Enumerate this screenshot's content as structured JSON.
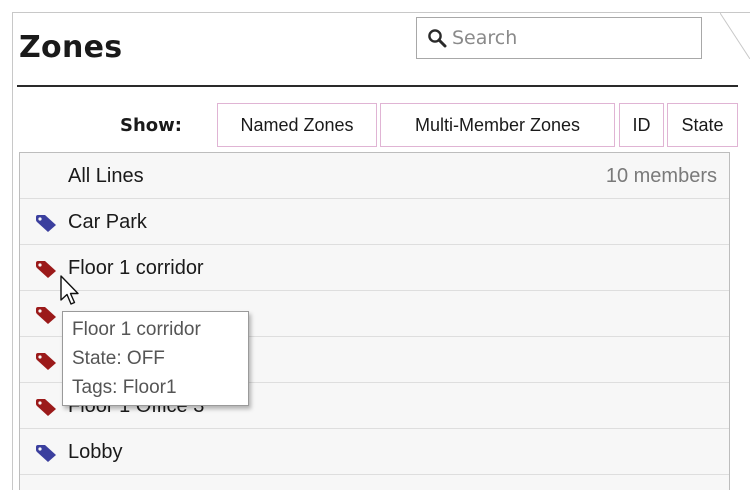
{
  "title": "Zones",
  "search": {
    "placeholder": "Search"
  },
  "filter": {
    "show_label": "Show:",
    "chips": [
      "Named Zones",
      "Multi-Member Zones",
      "ID",
      "State"
    ]
  },
  "list": {
    "all_lines": {
      "label": "All Lines",
      "count": "10 members"
    },
    "rows": [
      {
        "label": "Car Park",
        "icon": "tag-blue-icon",
        "color": "#3b3f9e"
      },
      {
        "label": "Floor 1 corridor",
        "icon": "tag-red-icon",
        "color": "#9b1a1a"
      },
      {
        "label": "",
        "icon": "tag-red-icon",
        "color": "#9b1a1a"
      },
      {
        "label": "",
        "icon": "tag-red-icon",
        "color": "#9b1a1a"
      },
      {
        "label": "Floor 1 Office 3",
        "icon": "tag-red-icon",
        "color": "#9b1a1a"
      },
      {
        "label": "Lobby",
        "icon": "tag-blue-icon",
        "color": "#3b3f9e"
      }
    ]
  },
  "tooltip": {
    "lines": [
      "Floor 1 corridor",
      "State: OFF",
      "Tags: Floor1"
    ]
  }
}
